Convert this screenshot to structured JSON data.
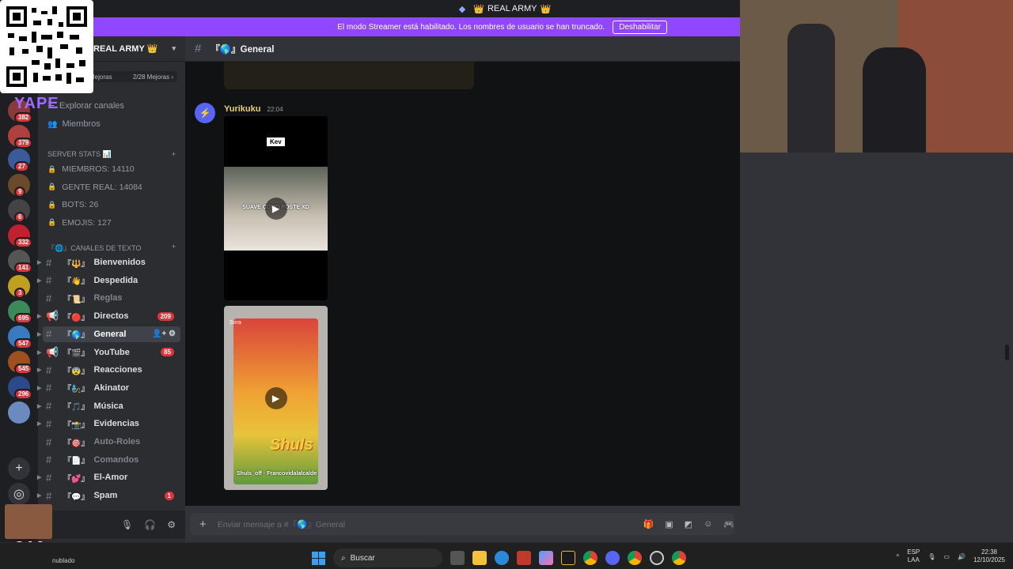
{
  "titlebar": {
    "server_icon": "shield-icon",
    "title": "REAL ARMY",
    "crown": "👑"
  },
  "streamer_banner": {
    "message": "El modo Streamer está habilitado. Los nombres de usuario se han truncado.",
    "button_label": "Deshabilitar",
    "color": "#9147ff"
  },
  "overlays": {
    "yape_text": "YAPE",
    "counter_text": "x816"
  },
  "server": {
    "name": "REAL ARMY",
    "crown": "👑",
    "boost_left": "Mejoras",
    "boost_right": "2/28 Mejoras"
  },
  "rail_badges": [
    "382",
    "379",
    "27",
    "9",
    "6",
    "332",
    "141",
    "3",
    "695",
    "547",
    "545",
    "296"
  ],
  "sidebar_links": [
    {
      "icon": "browse-channels-icon",
      "label": "Explorar canales"
    },
    {
      "icon": "members-icon",
      "label": "Miembros"
    }
  ],
  "stats_category": {
    "label": "SERVER STATS 📊"
  },
  "stats": [
    "MIEMBROS: 14110",
    "GENTE REAL: 14084",
    "BOTS: 26",
    "EMOJIS: 127"
  ],
  "text_category": {
    "label": "『🌐』CANALES DE TEXTO"
  },
  "channels": [
    {
      "name": "Bienvenidos",
      "deco": "『🔱』",
      "badge": "",
      "muted": false
    },
    {
      "name": "Despedida",
      "deco": "『👋』",
      "badge": "",
      "muted": false
    },
    {
      "name": "Reglas",
      "deco": "『📜』",
      "badge": "",
      "muted": true
    },
    {
      "name": "Directos",
      "deco": "『🔴』",
      "badge": "209",
      "muted": false
    },
    {
      "name": "General",
      "deco": "『🌎』",
      "badge": "",
      "muted": false
    },
    {
      "name": "YouTube",
      "deco": "『🎬』",
      "badge": "85",
      "muted": false
    },
    {
      "name": "Reacciones",
      "deco": "『😨』",
      "badge": "",
      "muted": false
    },
    {
      "name": "Akinator",
      "deco": "『🧞』",
      "badge": "",
      "muted": false
    },
    {
      "name": "Música",
      "deco": "『🎵』",
      "badge": "",
      "muted": false
    },
    {
      "name": "Evidencias",
      "deco": "『📸』",
      "badge": "",
      "muted": false
    },
    {
      "name": "Auto-Roles",
      "deco": "『🎯』",
      "badge": "",
      "muted": true
    },
    {
      "name": "Comandos",
      "deco": "『📄』",
      "badge": "",
      "muted": true
    },
    {
      "name": "El-Amor",
      "deco": "『💕』",
      "badge": "",
      "muted": false
    },
    {
      "name": "Spam",
      "deco": "『💬』",
      "badge": "1",
      "muted": false
    }
  ],
  "chat": {
    "channel": "『🌎』General",
    "message": {
      "author": "Yurikuku",
      "time": "22:04"
    },
    "video1": {
      "top_label": "Kev",
      "caption": "SUAVE COMO POSTE XD"
    },
    "video2": {
      "watermark": "Sora",
      "toy_brand": "Shuls",
      "toy_credit": "Shuls_off · Francovidalalcalde"
    },
    "composer_placeholder": "Enviar mensaje a #『🌎』General"
  },
  "taskbar": {
    "weather": "nublado",
    "search_label": "Buscar",
    "language": "ESP",
    "layout": "LAA",
    "time": "22:38",
    "date": "12/10/2025"
  }
}
